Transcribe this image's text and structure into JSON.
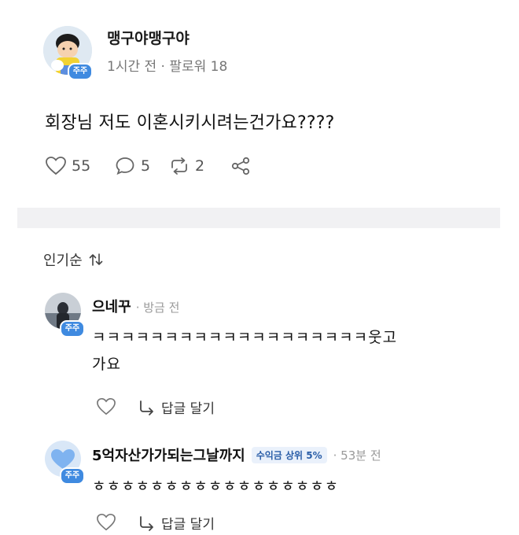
{
  "post": {
    "author": "맹구야맹구야",
    "badge": "주주",
    "time": "1시간 전",
    "followers": "팔로워 18",
    "separator": "·",
    "body": "회장님 저도 이혼시키시려는건가요????",
    "likes": "55",
    "comments": "5",
    "reposts": "2"
  },
  "comments_section": {
    "sort_label": "인기순",
    "items": [
      {
        "author": "으네꾸",
        "badge": "주주",
        "time": "· 방금 전",
        "text_line1": "ㅋㅋㅋㅋㅋㅋㅋㅋㅋㅋㅋㅋㅋㅋㅋㅋㅋㅋㅋ웃고",
        "text_line2": "가요",
        "reply_label": "답글 달기"
      },
      {
        "author": "5억자산가가되는그날까지",
        "badge": "주주",
        "rank": "수익금 상위 5%",
        "time": "· 53분 전",
        "text_line1": "ㅎㅎㅎㅎㅎㅎㅎㅎㅎㅎㅎㅎㅎㅎㅎㅎㅎ",
        "reply_label": "답글 달기"
      }
    ]
  },
  "colors": {
    "badge": "#3f8ae0",
    "band": "#f1f1f3"
  }
}
